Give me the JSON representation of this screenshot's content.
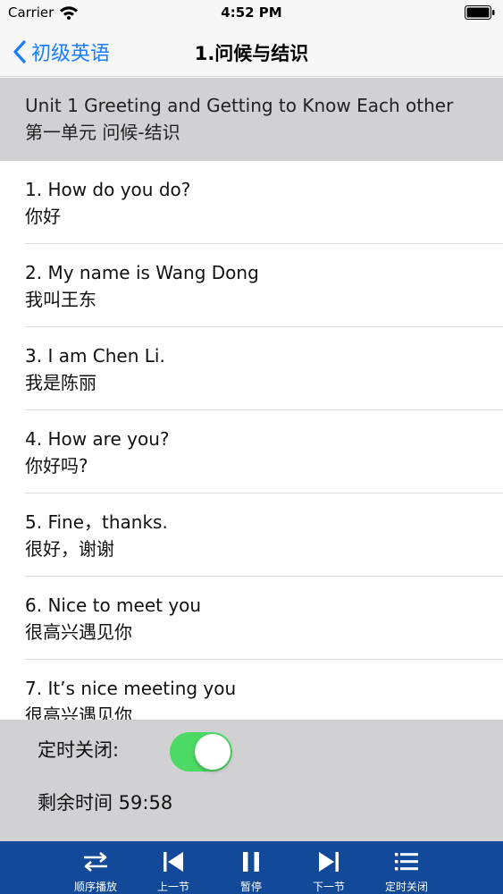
{
  "status_bar": {
    "carrier": "Carrier",
    "time": "4:52 PM"
  },
  "nav": {
    "back_label": "初级英语",
    "title": "1.问候与结识"
  },
  "section": {
    "title_en": "Unit 1  Greeting and Getting to Know Each other",
    "title_cn": "第一单元 问候-结识"
  },
  "lessons": [
    {
      "en": "1.  How do you do?",
      "cn": "你好"
    },
    {
      "en": "2.  My name is Wang Dong",
      "cn": "我叫王东"
    },
    {
      "en": "3.  I am Chen Li.",
      "cn": "我是陈丽"
    },
    {
      "en": "4.  How are you?",
      "cn": "你好吗?"
    },
    {
      "en": "5.  Fine，thanks.",
      "cn": "很好，谢谢"
    },
    {
      "en": "6.  Nice to meet you",
      "cn": "很高兴遇见你"
    },
    {
      "en": "7.  It’s nice meeting you",
      "cn": "很高兴遇见你"
    }
  ],
  "timer": {
    "label": "定时关闭:",
    "enabled": true,
    "remaining": "剩余时间 59:58"
  },
  "tab_bar": {
    "items": [
      {
        "label": "顺序播放",
        "icon": "shuffle-order-icon"
      },
      {
        "label": "上一节",
        "icon": "previous-track-icon"
      },
      {
        "label": "暂停",
        "icon": "pause-icon"
      },
      {
        "label": "下一节",
        "icon": "next-track-icon"
      },
      {
        "label": "定时关闭",
        "icon": "list-timer-icon"
      }
    ]
  },
  "colors": {
    "accent": "#1a7dff",
    "toggle_on": "#4cd964",
    "tab_bar_bg": "#124a99",
    "header_bg": "#d1d1d4"
  }
}
